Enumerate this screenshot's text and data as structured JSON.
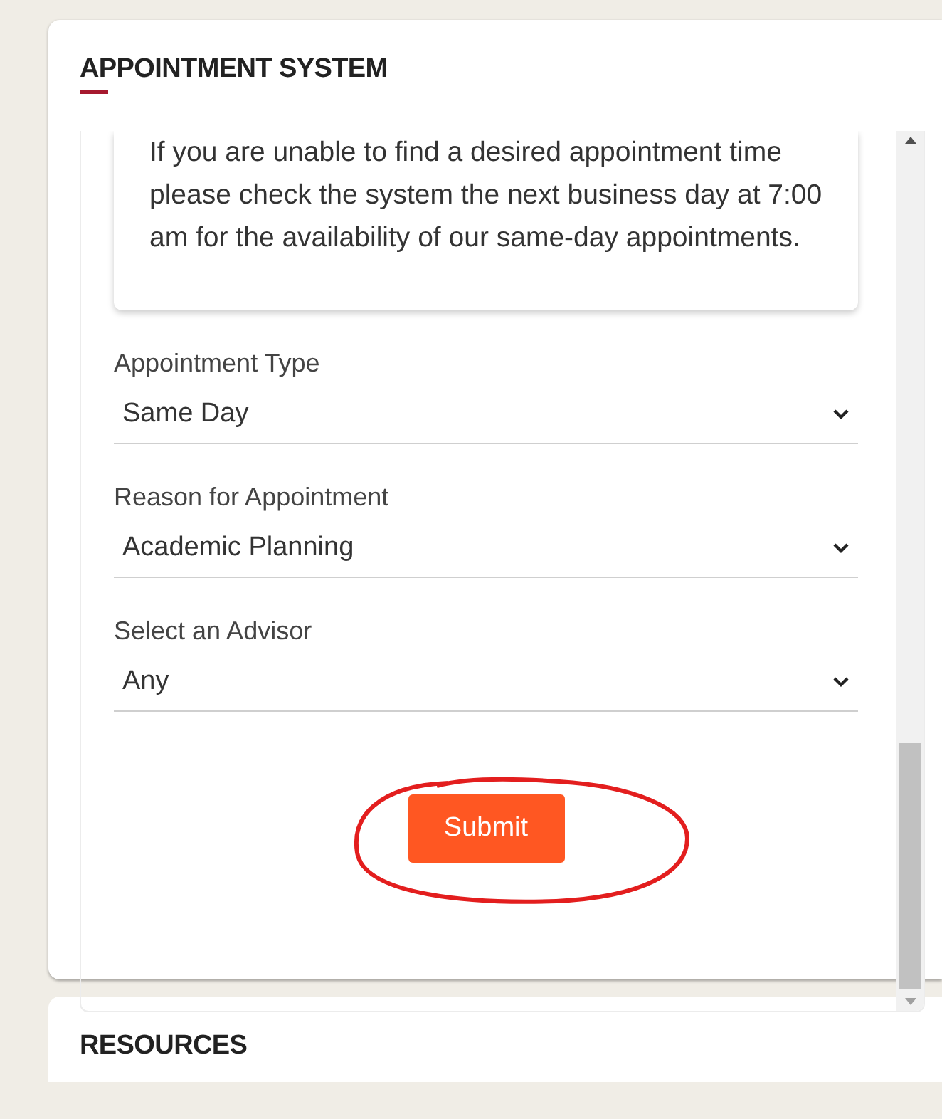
{
  "card": {
    "title": "APPOINTMENT SYSTEM"
  },
  "notice": "If you are unable to find a desired appointment time please check the system the next business day at 7:00 am for the availability of our same-day appointments.",
  "fields": [
    {
      "label": "Appointment Type",
      "value": "Same Day"
    },
    {
      "label": "Reason for Appointment",
      "value": "Academic Planning"
    },
    {
      "label": "Select an Advisor",
      "value": "Any"
    }
  ],
  "submit": "Submit",
  "next_card": {
    "title": "RESOURCES"
  }
}
